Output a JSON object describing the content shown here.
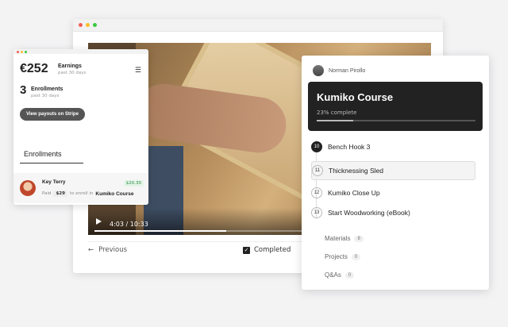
{
  "video": {
    "time": "4:03 / 10:33",
    "progress": 0.4,
    "previous_label": "Previous",
    "completed_label": "Completed"
  },
  "earnings": {
    "amount": "€252",
    "earnings_label": "Earnings",
    "earnings_sub": "past 30 days",
    "enroll_count": "3",
    "enroll_label": "Enrollments",
    "enroll_sub": "past 30 days",
    "payout_button": "View payouts on Stripe",
    "tab_label": "Enrollments",
    "entry": {
      "name": "Key Terry",
      "price": "$20.30",
      "paid_label": "Paid",
      "paid_amount": "$29",
      "to_enroll": "to enroll in",
      "course": "Kumiko Course"
    }
  },
  "course": {
    "author": "Norman Pirollo",
    "title": "Kumiko Course",
    "progress_text": "23% complete",
    "progress": 0.23,
    "lessons": [
      {
        "num": "10",
        "title": "Bench Hook 3"
      },
      {
        "num": "11",
        "title": "Thicknessing Sled"
      },
      {
        "num": "12",
        "title": "Kumiko Close Up"
      },
      {
        "num": "13",
        "title": "Start Woodworking (eBook)"
      }
    ],
    "sections": [
      {
        "label": "Materials",
        "count": "8"
      },
      {
        "label": "Projects",
        "count": "0"
      },
      {
        "label": "Q&As",
        "count": "0"
      }
    ]
  },
  "colors": {
    "dot_red": "#f25f58",
    "dot_yellow": "#fbbe2e",
    "dot_green": "#39c840",
    "price_green": "#2c8a45"
  }
}
